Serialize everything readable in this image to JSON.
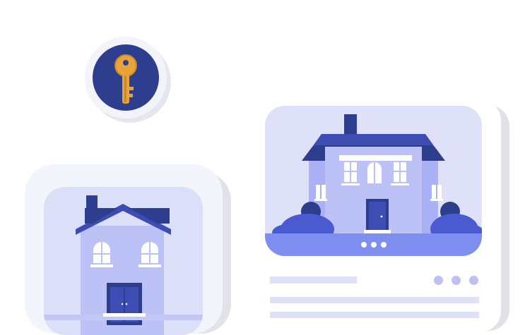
{
  "illustration": {
    "icons": {
      "key": "key-icon",
      "house_front": "house-icon",
      "house_large": "house-icon"
    },
    "listing_card": {
      "carousel_dots": 3,
      "option_dots": 3
    },
    "colors": {
      "navy": "#2e3e8e",
      "key_gold": "#e8a33a",
      "house_wall": "#bcc2f6",
      "roof": "#3d4db3",
      "bush": "#4a5ad0",
      "lawn": "#7f8ff0",
      "card_bg": "#f3f5fc",
      "placeholder": "#dfe1f8"
    }
  }
}
